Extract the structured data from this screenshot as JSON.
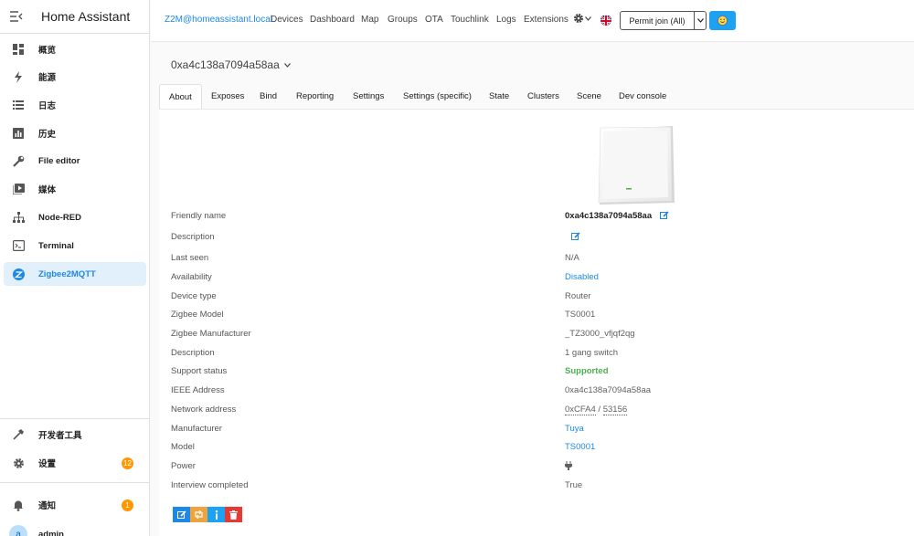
{
  "sidebar": {
    "title": "Home Assistant",
    "items": [
      {
        "label": "概览",
        "icon": "dashboard-icon"
      },
      {
        "label": "能源",
        "icon": "lightning-icon"
      },
      {
        "label": "日志",
        "icon": "list-icon"
      },
      {
        "label": "历史",
        "icon": "chart-icon"
      },
      {
        "label": "File editor",
        "icon": "wrench-icon"
      },
      {
        "label": "媒体",
        "icon": "play-icon"
      },
      {
        "label": "Node-RED",
        "icon": "sitemap-icon"
      },
      {
        "label": "Terminal",
        "icon": "console-icon"
      },
      {
        "label": "Zigbee2MQTT",
        "icon": "zigbee-icon"
      }
    ],
    "dev_tools": "开发者工具",
    "settings": "设置",
    "settings_badge": "12",
    "notifications": "通知",
    "notifications_badge": "1",
    "user": "admin",
    "user_initial": "a"
  },
  "topbar": {
    "brand": "Z2M@homeassistant.local",
    "links": [
      "Devices",
      "Dashboard",
      "Map",
      "Groups",
      "OTA",
      "Touchlink",
      "Logs",
      "Extensions"
    ],
    "permit_join": "Permit join (All)"
  },
  "device": {
    "title": "0xa4c138a7094a58aa"
  },
  "tabs": [
    "About",
    "Exposes",
    "Bind",
    "Reporting",
    "Settings",
    "Settings (specific)",
    "State",
    "Clusters",
    "Scene",
    "Dev console"
  ],
  "rows": [
    {
      "label": "Friendly name",
      "value": "0xa4c138a7094a58aa"
    },
    {
      "label": "Description",
      "value": ""
    },
    {
      "label": "Last seen",
      "value": "N/A"
    },
    {
      "label": "Availability",
      "value": "Disabled"
    },
    {
      "label": "Device type",
      "value": "Router"
    },
    {
      "label": "Zigbee Model",
      "value": "TS0001"
    },
    {
      "label": "Zigbee Manufacturer",
      "value": "_TZ3000_vfjqf2qg"
    },
    {
      "label": "Description",
      "value": "1 gang switch"
    },
    {
      "label": "Support status",
      "value": "Supported"
    },
    {
      "label": "IEEE Address",
      "value": "0xa4c138a7094a58aa"
    },
    {
      "label": "Network address",
      "value_hex": "0xCFA4",
      "value_sep": " / ",
      "value_dec": "53156"
    },
    {
      "label": "Manufacturer",
      "value": "Tuya"
    },
    {
      "label": "Model",
      "value": "TS0001"
    },
    {
      "label": "Power",
      "value": ""
    },
    {
      "label": "Interview completed",
      "value": "True"
    }
  ],
  "colors": {
    "accent": "#1e88e5",
    "supported": "#4caf50",
    "badge": "#ff9800",
    "delete": "#e53935"
  }
}
